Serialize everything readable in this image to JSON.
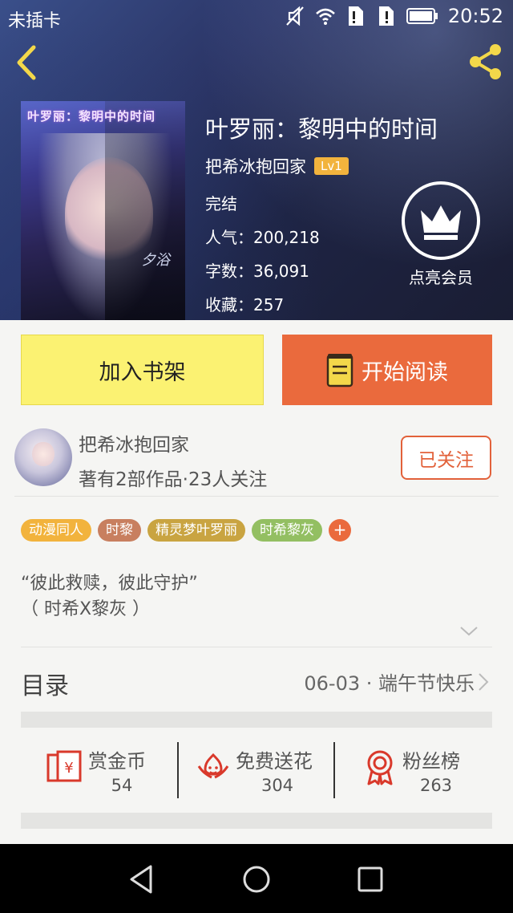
{
  "status_bar": {
    "carrier": "未插卡",
    "time": "20:52"
  },
  "header": {
    "back_icon": "chevron-left-icon",
    "share_icon": "share-icon"
  },
  "book": {
    "cover_title": "叶罗丽：黎明中的时间",
    "cover_signature": "夕浴",
    "title": "叶罗丽：黎明中的时间",
    "author": "把希冰抱回家",
    "level": "Lv1",
    "status": "完结",
    "popularity": "人气：200,218",
    "word_count": "字数：36,091",
    "favorites": "收藏：257"
  },
  "vip": {
    "label": "点亮会员",
    "icon": "crown-icon"
  },
  "actions": {
    "add_shelf": "加入书架",
    "start_read": "开始阅读"
  },
  "author_card": {
    "name": "把希冰抱回家",
    "meta": "著有2部作品·23人关注",
    "follow_label": "已关注"
  },
  "tags": [
    {
      "label": "动漫同人",
      "color": "#f2b33d"
    },
    {
      "label": "时黎",
      "color": "#c87f5f"
    },
    {
      "label": "精灵梦叶罗丽",
      "color": "#c9a441"
    },
    {
      "label": "时希黎灰",
      "color": "#93bf62"
    }
  ],
  "tag_add": "+",
  "description": {
    "line1": "“彼此救赎，彼此守护”",
    "line2": "（ 时希X黎灰 ）"
  },
  "toc": {
    "label": "目录",
    "latest": "06-03 · 端午节快乐"
  },
  "stats": [
    {
      "label": "赏金币",
      "value": "54",
      "icon": "red-envelope-yen-icon"
    },
    {
      "label": "免费送花",
      "value": "304",
      "icon": "flower-icon"
    },
    {
      "label": "粉丝榜",
      "value": "263",
      "icon": "medal-ribbon-icon"
    }
  ],
  "colors": {
    "accent_orange": "#ea6a3d",
    "shelf_yellow": "#fbf272",
    "stat_icon_red": "#d9392b"
  }
}
